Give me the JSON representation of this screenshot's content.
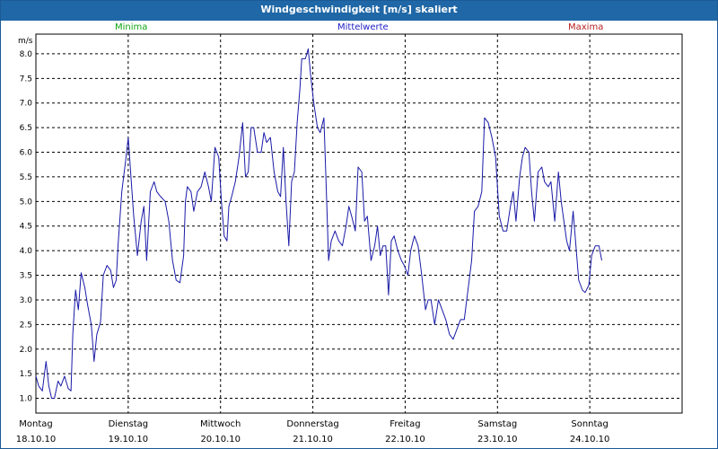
{
  "window": {
    "title": "Windgeschwindigkeit [m/s] skaliert"
  },
  "legend": {
    "minima": "Minima",
    "mittelwerte": "Mittelwerte",
    "maxima": "Maxima",
    "colors": {
      "minima": "#12a612",
      "mittelwerte": "#2121c8",
      "maxima": "#b82020"
    }
  },
  "chart_data": {
    "type": "line",
    "title": "Windgeschwindigkeit [m/s] skaliert",
    "ylabel": "m/s",
    "xlabel": "",
    "ylim": [
      0.7,
      8.4
    ],
    "xlim": [
      0,
      7
    ],
    "grid": true,
    "y_ticks": [
      "1.0",
      "1.5",
      "2.0",
      "2.5",
      "3.0",
      "3.5",
      "4.0",
      "4.5",
      "5.0",
      "5.5",
      "6.0",
      "6.5",
      "7.0",
      "7.5",
      "8.0"
    ],
    "x_ticks": [
      {
        "day": "Montag",
        "date": "18.10.10"
      },
      {
        "day": "Dienstag",
        "date": "19.10.10"
      },
      {
        "day": "Mittwoch",
        "date": "20.10.10"
      },
      {
        "day": "Donnerstag",
        "date": "21.10.10"
      },
      {
        "day": "Freitag",
        "date": "22.10.10"
      },
      {
        "day": "Samstag",
        "date": "23.10.10"
      },
      {
        "day": "Sonntag",
        "date": "24.10.10"
      }
    ],
    "series": [
      {
        "name": "Mittelwerte",
        "color": "#1a1aa8",
        "points": [
          [
            0.0,
            1.45
          ],
          [
            0.03,
            1.25
          ],
          [
            0.07,
            1.15
          ],
          [
            0.11,
            1.75
          ],
          [
            0.14,
            1.25
          ],
          [
            0.17,
            1.0
          ],
          [
            0.2,
            1.0
          ],
          [
            0.24,
            1.35
          ],
          [
            0.27,
            1.25
          ],
          [
            0.31,
            1.45
          ],
          [
            0.35,
            1.2
          ],
          [
            0.38,
            1.15
          ],
          [
            0.4,
            2.3
          ],
          [
            0.43,
            3.2
          ],
          [
            0.46,
            2.8
          ],
          [
            0.49,
            3.55
          ],
          [
            0.53,
            3.25
          ],
          [
            0.56,
            2.9
          ],
          [
            0.6,
            2.5
          ],
          [
            0.63,
            1.75
          ],
          [
            0.66,
            2.3
          ],
          [
            0.7,
            2.55
          ],
          [
            0.73,
            3.5
          ],
          [
            0.77,
            3.7
          ],
          [
            0.81,
            3.6
          ],
          [
            0.84,
            3.25
          ],
          [
            0.87,
            3.4
          ],
          [
            0.89,
            4.1
          ],
          [
            0.93,
            5.2
          ],
          [
            0.97,
            5.8
          ],
          [
            1.0,
            6.3
          ],
          [
            1.03,
            5.5
          ],
          [
            1.06,
            4.7
          ],
          [
            1.1,
            3.9
          ],
          [
            1.14,
            4.6
          ],
          [
            1.17,
            4.9
          ],
          [
            1.2,
            3.8
          ],
          [
            1.24,
            5.2
          ],
          [
            1.28,
            5.4
          ],
          [
            1.31,
            5.2
          ],
          [
            1.35,
            5.1
          ],
          [
            1.4,
            5.0
          ],
          [
            1.44,
            4.6
          ],
          [
            1.48,
            3.8
          ],
          [
            1.52,
            3.4
          ],
          [
            1.56,
            3.35
          ],
          [
            1.6,
            3.9
          ],
          [
            1.62,
            5.0
          ],
          [
            1.64,
            5.3
          ],
          [
            1.68,
            5.2
          ],
          [
            1.71,
            4.8
          ],
          [
            1.75,
            5.2
          ],
          [
            1.79,
            5.3
          ],
          [
            1.83,
            5.6
          ],
          [
            1.87,
            5.3
          ],
          [
            1.9,
            5.0
          ],
          [
            1.94,
            6.1
          ],
          [
            1.98,
            5.9
          ],
          [
            2.01,
            5.0
          ],
          [
            2.04,
            4.3
          ],
          [
            2.07,
            4.2
          ],
          [
            2.09,
            4.9
          ],
          [
            2.12,
            5.1
          ],
          [
            2.16,
            5.4
          ],
          [
            2.2,
            5.9
          ],
          [
            2.24,
            6.6
          ],
          [
            2.27,
            5.5
          ],
          [
            2.3,
            5.6
          ],
          [
            2.33,
            6.5
          ],
          [
            2.36,
            6.5
          ],
          [
            2.4,
            6.0
          ],
          [
            2.44,
            6.0
          ],
          [
            2.47,
            6.4
          ],
          [
            2.5,
            6.2
          ],
          [
            2.54,
            6.3
          ],
          [
            2.58,
            5.6
          ],
          [
            2.62,
            5.2
          ],
          [
            2.65,
            5.1
          ],
          [
            2.68,
            6.1
          ],
          [
            2.71,
            5.0
          ],
          [
            2.74,
            4.1
          ],
          [
            2.77,
            5.4
          ],
          [
            2.8,
            5.6
          ],
          [
            2.83,
            6.6
          ],
          [
            2.86,
            7.3
          ],
          [
            2.88,
            7.9
          ],
          [
            2.92,
            7.9
          ],
          [
            2.95,
            8.1
          ],
          [
            2.98,
            7.5
          ],
          [
            3.01,
            7.0
          ],
          [
            3.05,
            6.5
          ],
          [
            3.08,
            6.4
          ],
          [
            3.12,
            6.7
          ],
          [
            3.15,
            5.0
          ],
          [
            3.17,
            3.8
          ],
          [
            3.2,
            4.2
          ],
          [
            3.24,
            4.4
          ],
          [
            3.28,
            4.2
          ],
          [
            3.32,
            4.1
          ],
          [
            3.36,
            4.5
          ],
          [
            3.39,
            4.9
          ],
          [
            3.42,
            4.7
          ],
          [
            3.46,
            4.4
          ],
          [
            3.49,
            5.7
          ],
          [
            3.53,
            5.6
          ],
          [
            3.56,
            4.6
          ],
          [
            3.59,
            4.7
          ],
          [
            3.63,
            3.8
          ],
          [
            3.67,
            4.1
          ],
          [
            3.7,
            4.5
          ],
          [
            3.73,
            3.9
          ],
          [
            3.76,
            4.1
          ],
          [
            3.79,
            4.1
          ],
          [
            3.82,
            3.1
          ],
          [
            3.85,
            4.2
          ],
          [
            3.88,
            4.3
          ],
          [
            3.92,
            4.0
          ],
          [
            3.96,
            3.8
          ],
          [
            3.99,
            3.7
          ],
          [
            4.03,
            3.5
          ],
          [
            4.06,
            4.0
          ],
          [
            4.1,
            4.3
          ],
          [
            4.14,
            4.1
          ],
          [
            4.18,
            3.5
          ],
          [
            4.22,
            2.8
          ],
          [
            4.25,
            3.0
          ],
          [
            4.28,
            3.0
          ],
          [
            4.32,
            2.5
          ],
          [
            4.36,
            3.0
          ],
          [
            4.4,
            2.8
          ],
          [
            4.44,
            2.6
          ],
          [
            4.48,
            2.3
          ],
          [
            4.52,
            2.2
          ],
          [
            4.56,
            2.4
          ],
          [
            4.6,
            2.6
          ],
          [
            4.64,
            2.6
          ],
          [
            4.68,
            3.2
          ],
          [
            4.72,
            3.8
          ],
          [
            4.75,
            4.8
          ],
          [
            4.79,
            4.9
          ],
          [
            4.83,
            5.2
          ],
          [
            4.86,
            6.7
          ],
          [
            4.9,
            6.6
          ],
          [
            4.94,
            6.3
          ],
          [
            4.98,
            5.9
          ],
          [
            5.02,
            4.7
          ],
          [
            5.06,
            4.4
          ],
          [
            5.1,
            4.4
          ],
          [
            5.14,
            4.9
          ],
          [
            5.17,
            5.2
          ],
          [
            5.2,
            4.6
          ],
          [
            5.24,
            5.5
          ],
          [
            5.27,
            5.9
          ],
          [
            5.3,
            6.1
          ],
          [
            5.34,
            6.0
          ],
          [
            5.37,
            5.2
          ],
          [
            5.4,
            4.6
          ],
          [
            5.44,
            5.6
          ],
          [
            5.48,
            5.7
          ],
          [
            5.51,
            5.4
          ],
          [
            5.55,
            5.3
          ],
          [
            5.58,
            5.4
          ],
          [
            5.62,
            4.6
          ],
          [
            5.66,
            5.6
          ],
          [
            5.69,
            5.0
          ],
          [
            5.72,
            4.6
          ],
          [
            5.75,
            4.2
          ],
          [
            5.78,
            4.0
          ],
          [
            5.82,
            4.8
          ],
          [
            5.85,
            4.1
          ],
          [
            5.88,
            3.4
          ],
          [
            5.92,
            3.2
          ],
          [
            5.95,
            3.15
          ],
          [
            5.99,
            3.3
          ],
          [
            6.02,
            3.9
          ],
          [
            6.06,
            4.1
          ],
          [
            6.1,
            4.1
          ],
          [
            6.13,
            3.8
          ]
        ]
      }
    ]
  }
}
